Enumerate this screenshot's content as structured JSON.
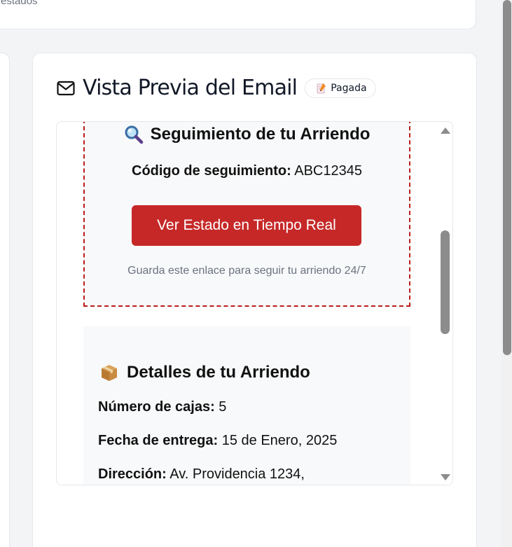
{
  "top_card": {
    "text": "estados"
  },
  "preview_panel": {
    "title": "Vista Previa del Email",
    "badge": "Pagada",
    "icons": {
      "header": "mail-icon",
      "badge": "memo-icon"
    }
  },
  "tracking": {
    "title": "Seguimiento de tu Arriendo",
    "icon": "magnifier-icon",
    "code_label": "Código de seguimiento:",
    "code_value": "ABC12345",
    "button_label": "Ver Estado en Tiempo Real",
    "note": "Guarda este enlace para seguir tu arriendo 24/7"
  },
  "details": {
    "title": "Detalles de tu Arriendo",
    "icon": "package-icon",
    "rows": [
      {
        "label": "Número de cajas:",
        "value": "5"
      },
      {
        "label": "Fecha de entrega:",
        "value": "15 de Enero, 2025"
      },
      {
        "label": "Dirección:",
        "value": "Av. Providencia 1234,"
      }
    ]
  },
  "colors": {
    "accent_red": "#c62828",
    "dashed_border": "#b91c1c",
    "panel_bg": "#f8f9fa"
  }
}
